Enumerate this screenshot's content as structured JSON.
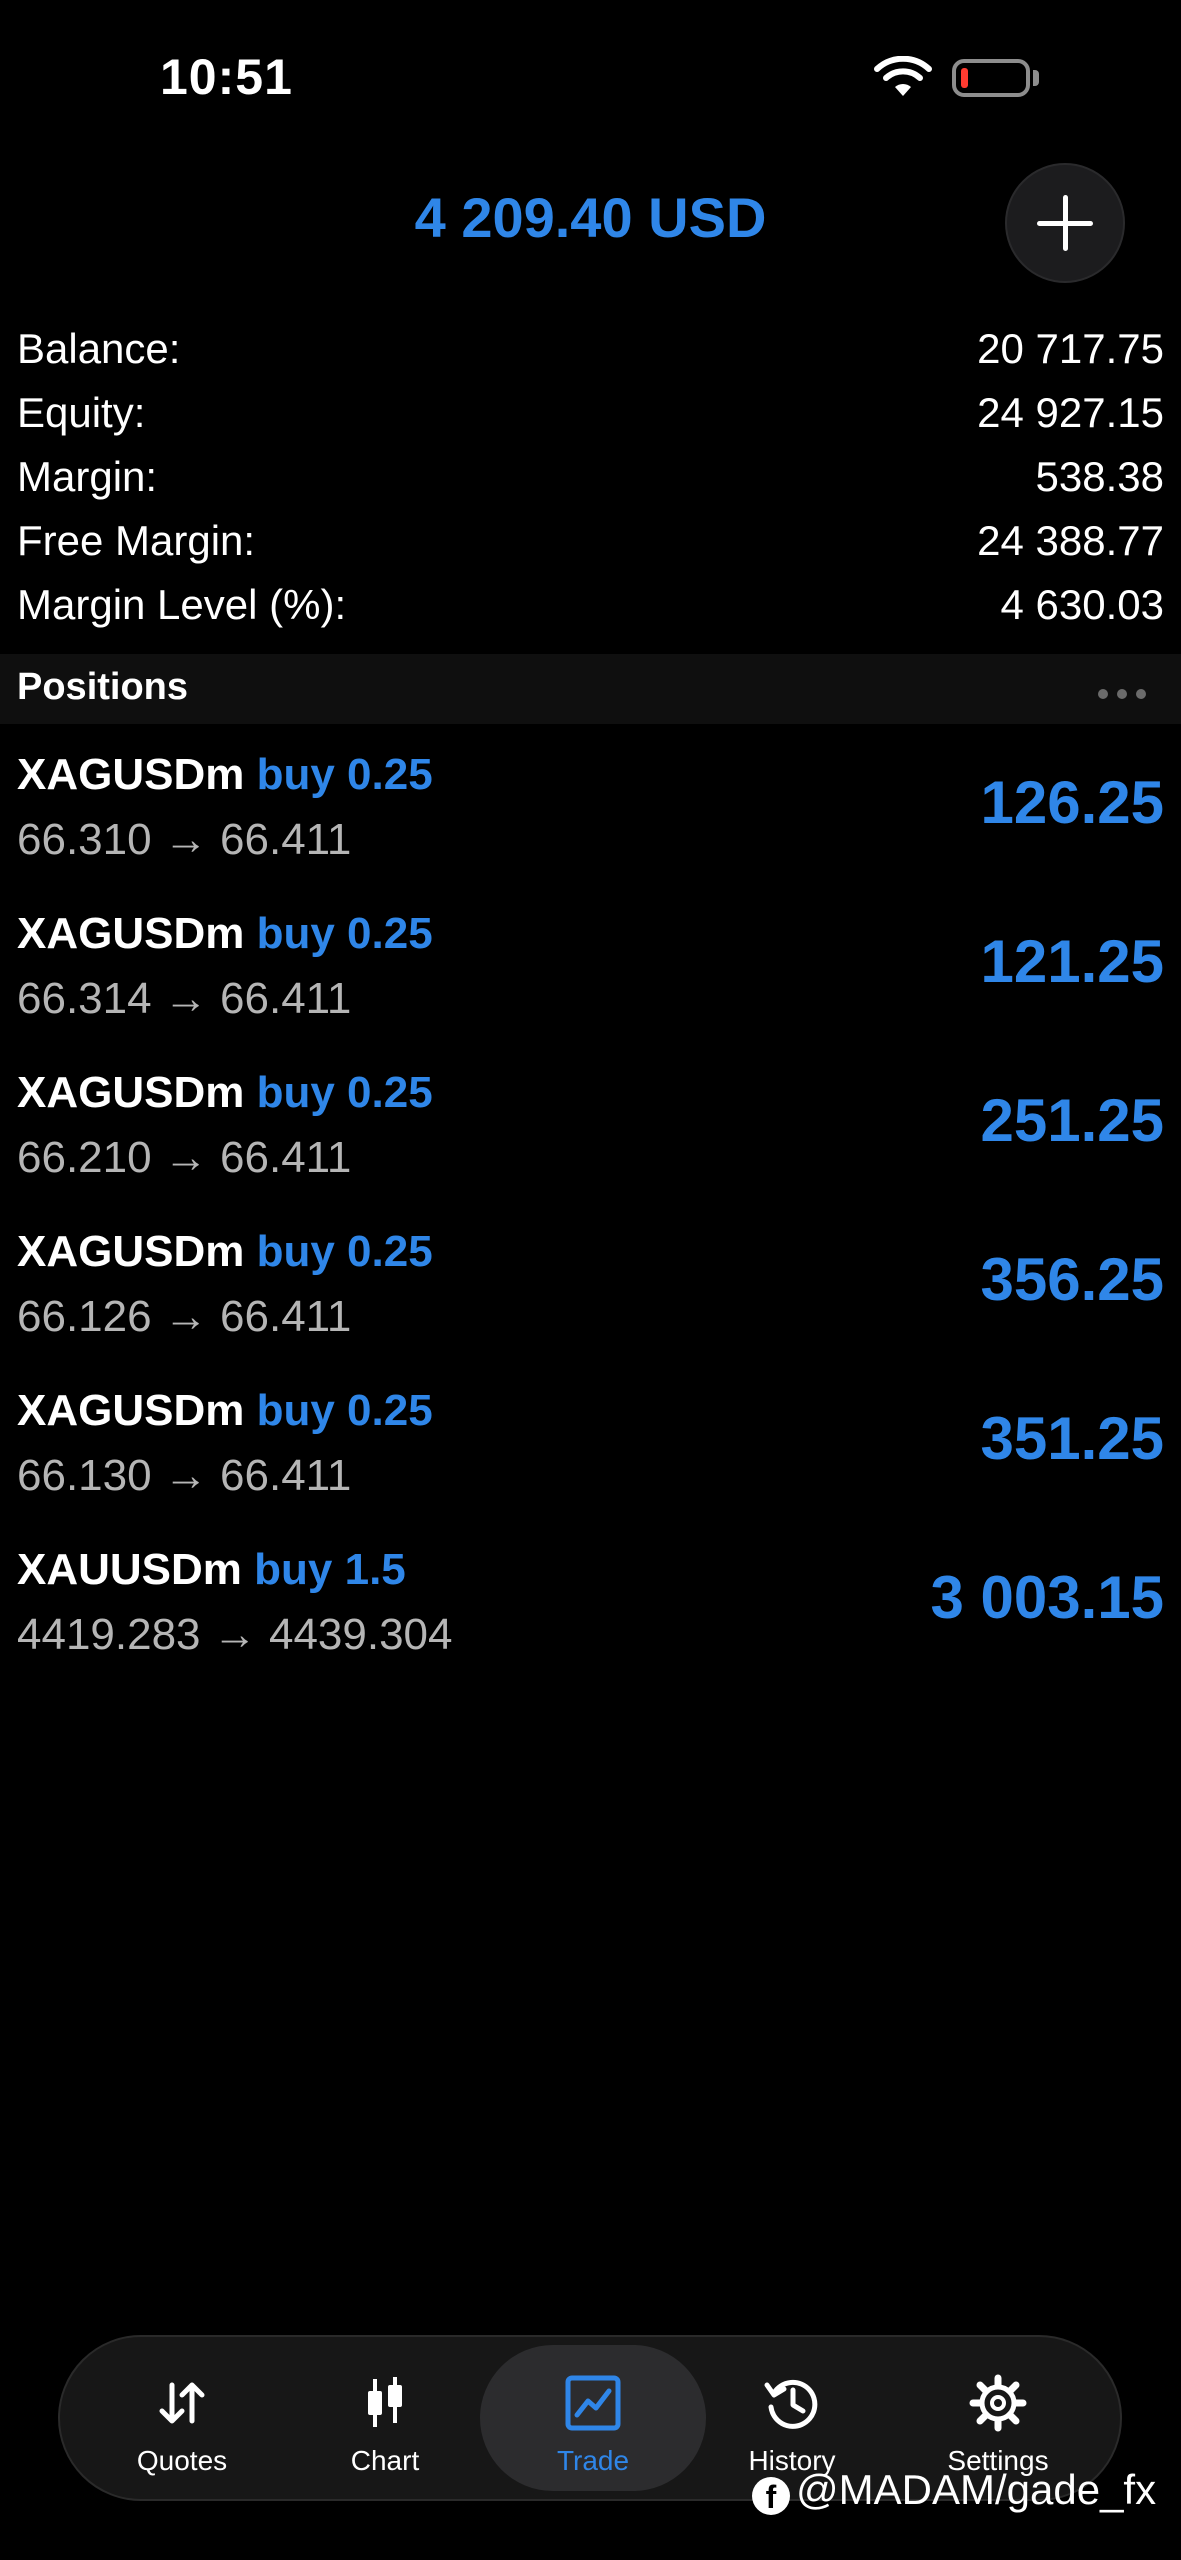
{
  "status": {
    "time": "10:51"
  },
  "header": {
    "total": "4 209.40 USD"
  },
  "summary": [
    {
      "label": "Balance:",
      "value": "20 717.75"
    },
    {
      "label": "Equity:",
      "value": "24 927.15"
    },
    {
      "label": "Margin:",
      "value": "538.38"
    },
    {
      "label": "Free Margin:",
      "value": "24 388.77"
    },
    {
      "label": "Margin Level (%):",
      "value": "4 630.03"
    }
  ],
  "positions": {
    "title": "Positions",
    "items": [
      {
        "symbol": "XAGUSDm",
        "side": "buy 0.25",
        "prices": "66.310 → 66.411",
        "profit": "126.25"
      },
      {
        "symbol": "XAGUSDm",
        "side": "buy 0.25",
        "prices": "66.314 → 66.411",
        "profit": "121.25"
      },
      {
        "symbol": "XAGUSDm",
        "side": "buy 0.25",
        "prices": "66.210 → 66.411",
        "profit": "251.25"
      },
      {
        "symbol": "XAGUSDm",
        "side": "buy 0.25",
        "prices": "66.126 → 66.411",
        "profit": "356.25"
      },
      {
        "symbol": "XAGUSDm",
        "side": "buy 0.25",
        "prices": "66.130 → 66.411",
        "profit": "351.25"
      },
      {
        "symbol": "XAUUSDm",
        "side": "buy 1.5",
        "prices": "4419.283 → 4439.304",
        "profit": "3 003.15"
      }
    ]
  },
  "tabs": [
    {
      "label": "Quotes",
      "icon": "quotes-arrows-icon"
    },
    {
      "label": "Chart",
      "icon": "candlestick-icon"
    },
    {
      "label": "Trade",
      "icon": "trade-chart-icon",
      "active": true
    },
    {
      "label": "History",
      "icon": "history-clock-icon"
    },
    {
      "label": "Settings",
      "icon": "gear-icon"
    }
  ],
  "watermark": {
    "text": "@MADAM/gade_fx"
  },
  "colors": {
    "accent": "#2f86e8",
    "background": "#000000",
    "muted": "#b5b5b5"
  }
}
